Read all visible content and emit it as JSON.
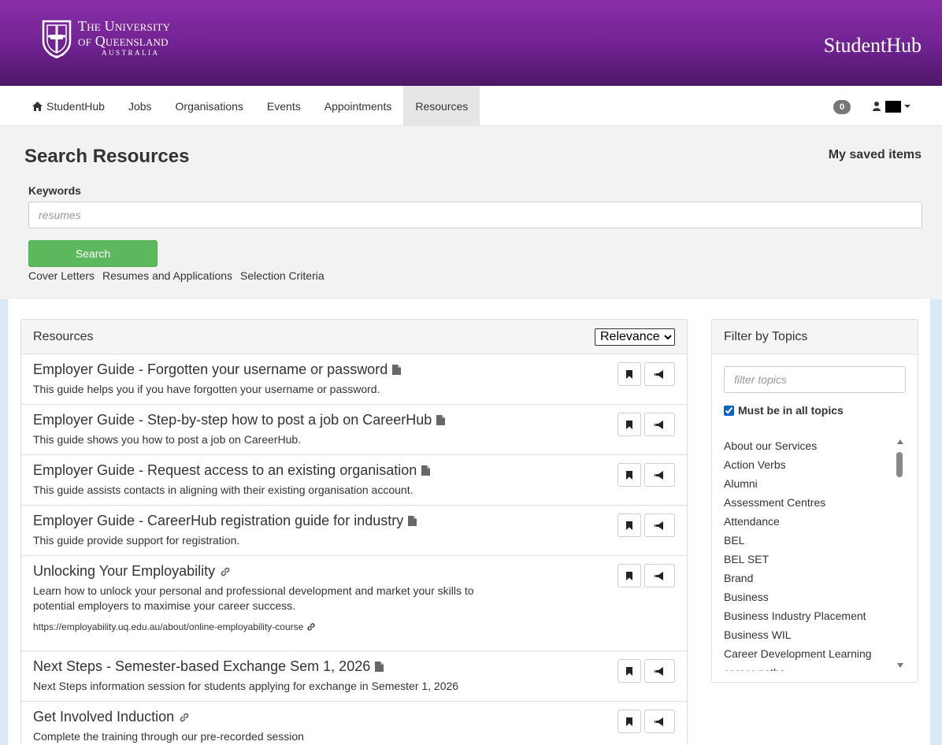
{
  "header": {
    "logo": {
      "line1": "The University",
      "line2": "of Queensland",
      "line3": "AUSTRALIA"
    },
    "brand": "StudentHub",
    "colors": {
      "header_top": "#8a2ea8",
      "header_bottom": "#4d1666"
    }
  },
  "nav": {
    "home_icon": "home-icon",
    "items": [
      {
        "label": "StudentHub"
      },
      {
        "label": "Jobs"
      },
      {
        "label": "Organisations"
      },
      {
        "label": "Events"
      },
      {
        "label": "Appointments"
      },
      {
        "label": "Resources",
        "active": true
      }
    ],
    "notification_count": "0",
    "user_icon": "user-icon"
  },
  "search": {
    "title": "Search Resources",
    "saved_items": "My saved items",
    "keywords_label": "Keywords",
    "keywords_value": "",
    "keywords_placeholder": "resumes",
    "button": "Search",
    "button_color": "#5cb85c",
    "quick_links": [
      "Cover Letters",
      "Resumes and Applications",
      "Selection Criteria"
    ]
  },
  "resources": {
    "heading": "Resources",
    "sort_selected": "Relevance",
    "items": [
      {
        "title": "Employer Guide - Forgotten your username or password",
        "type_icon": "file-icon",
        "desc": "This guide helps you if you have forgotten your username or password."
      },
      {
        "title": "Employer Guide - Step-by-step how to post a job on CareerHub",
        "type_icon": "file-icon",
        "desc": "This guide shows you how to post a job on CareerHub."
      },
      {
        "title": "Employer Guide - Request access to an existing organisation",
        "type_icon": "file-icon",
        "desc": "This guide assists contacts in aligning with their existing organisation account."
      },
      {
        "title": "Employer Guide - CareerHub registration guide for industry",
        "type_icon": "file-icon",
        "desc": "This guide provide support for registration."
      },
      {
        "title": "Unlocking Your Employability",
        "type_icon": "link-icon",
        "desc_line1": "Learn how to unlock your personal and professional development and market your skills to",
        "desc_line2": "potential employers to maximise your career success.",
        "url": "https://employability.uq.edu.au/about/online-employability-course"
      },
      {
        "title": "Next Steps - Semester-based Exchange Sem 1, 2026",
        "type_icon": "file-icon",
        "desc": "Next Steps information session for students applying for exchange in Semester 1, 2026"
      },
      {
        "title": "Get Involved Induction",
        "type_icon": "link-icon",
        "desc": "Complete the training through our pre-recorded session"
      }
    ]
  },
  "filter": {
    "heading": "Filter by Topics",
    "input_placeholder": "filter topics",
    "must_label": "Must be in all topics",
    "must_checked": true,
    "topics": [
      "About our Services",
      "Action Verbs",
      "Alumni",
      "Assessment Centres",
      "Attendance",
      "BEL",
      "BEL SET",
      "Brand",
      "Business",
      "Business Industry Placement",
      "Business WIL",
      "Career Development Learning",
      "career paths"
    ]
  }
}
